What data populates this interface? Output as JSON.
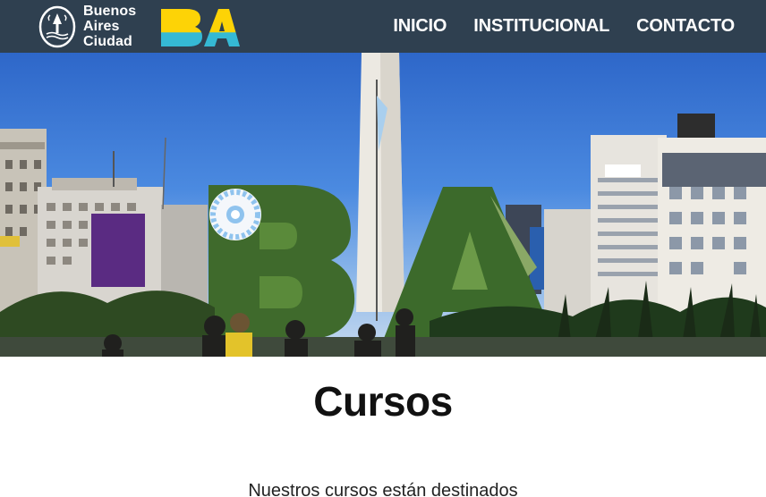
{
  "brand": {
    "line1": "Buenos",
    "line2": "Aires",
    "line3": "Ciudad",
    "seal_icon": "city-seal-icon",
    "ba_logo": "BA",
    "ba_colors": [
      "#fdd306",
      "#35b9d5"
    ]
  },
  "nav": {
    "items": [
      "INICIO",
      "INSTITUCIONAL",
      "CONTACTO"
    ]
  },
  "hero": {
    "image": "obelisk-ba-garden-photo"
  },
  "main": {
    "title": "Cursos",
    "intro": "Nuestros cursos están destinados"
  },
  "colors": {
    "navbar": "#2f4050",
    "text": "#111111"
  }
}
